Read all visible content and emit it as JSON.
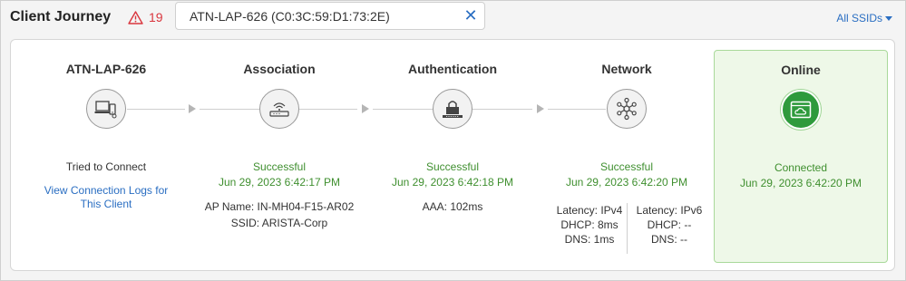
{
  "header": {
    "title": "Client Journey",
    "alert_count": "19",
    "search_value": "ATN-LAP-626 (C0:3C:59:D1:73:2E)",
    "ssid_filter": "All SSIDs"
  },
  "stages": {
    "client": {
      "title": "ATN-LAP-626",
      "status": "Tried to Connect",
      "link": "View Connection Logs for This Client",
      "icon": "laptop-icon"
    },
    "association": {
      "title": "Association",
      "status": "Successful",
      "time": "Jun 29, 2023 6:42:17 PM",
      "ap_name": "AP Name: IN-MH04-F15-AR02",
      "ssid": "SSID: ARISTA-Corp",
      "icon": "access-point-icon"
    },
    "authentication": {
      "title": "Authentication",
      "status": "Successful",
      "time": "Jun 29, 2023 6:42:18 PM",
      "aaa": "AAA: 102ms",
      "icon": "lock-icon"
    },
    "network": {
      "title": "Network",
      "status": "Successful",
      "time": "Jun 29, 2023 6:42:20 PM",
      "ipv4": {
        "latency": "Latency: IPv4",
        "dhcp": "DHCP: 8ms",
        "dns": "DNS: 1ms"
      },
      "ipv6": {
        "latency": "Latency: IPv6",
        "dhcp": "DHCP: --",
        "dns": "DNS: --"
      },
      "icon": "network-hub-icon"
    },
    "online": {
      "title": "Online",
      "status": "Connected",
      "time": "Jun 29, 2023 6:42:20 PM",
      "icon": "cloud-window-icon"
    }
  },
  "colors": {
    "success": "#3f8f2f",
    "link": "#2a6ec2",
    "alert": "#d9363e",
    "online_bg": "#eef8e8",
    "online_icon": "#2e9a3c"
  }
}
